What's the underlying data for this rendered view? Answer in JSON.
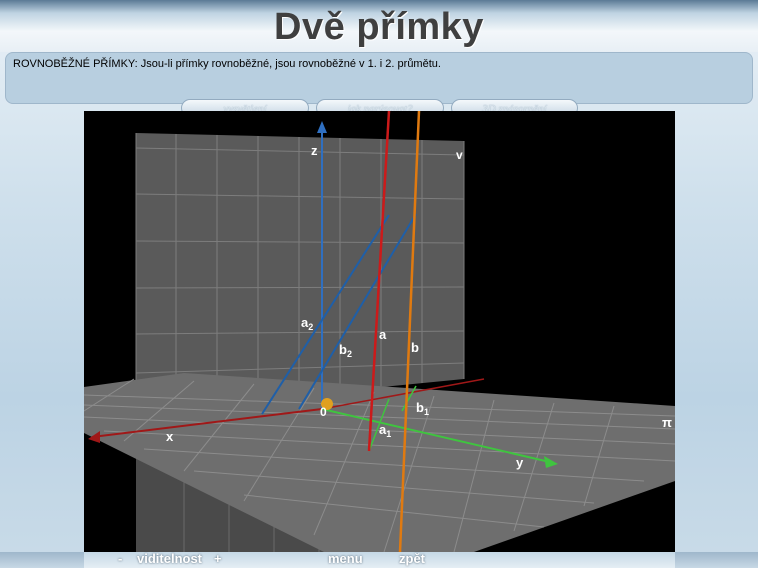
{
  "title": "Dvě přímky",
  "info": {
    "text": "ROVNOBĚŽNÉ PŘÍMKY: Jsou-li přímky rovnoběžné, jsou rovnoběžné v 1. i 2. průmětu."
  },
  "tabs": [
    {
      "label": "vysvětlení"
    },
    {
      "label": "jak narýsovat?"
    },
    {
      "label": "3D znázornění"
    }
  ],
  "scene": {
    "labels": {
      "z": "z",
      "v": "v",
      "x": "x",
      "y": "y",
      "pi": "π",
      "origin": "0",
      "a": "a",
      "b": "b",
      "a2_base": "a",
      "a2_sub": "2",
      "b2_base": "b",
      "b2_sub": "2",
      "a1_base": "a",
      "a1_sub": "1",
      "b1_base": "b",
      "b1_sub": "1"
    },
    "colors": {
      "line_a": "#cc1a1a",
      "line_b": "#e07a10",
      "projection": "#1f5fa8",
      "axis_x": "#a01818",
      "axis_y": "#3fc43f",
      "axis_z": "#2f6fc0",
      "origin": "#e0a020"
    }
  },
  "footer": {
    "visibility_minus": "-",
    "visibility_label": "viditelnost",
    "visibility_plus": "+",
    "menu": "menu",
    "back": "zpět"
  }
}
